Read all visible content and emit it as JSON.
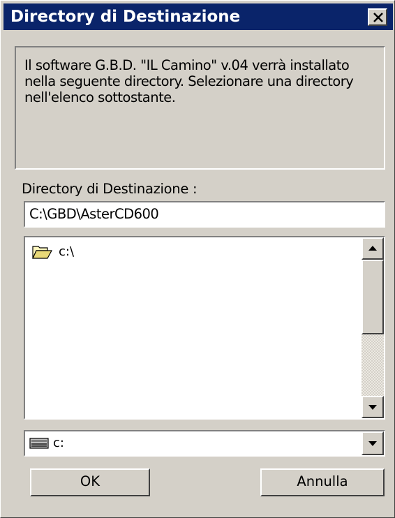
{
  "window": {
    "title": "Directory di Destinazione",
    "close_icon": "close-icon"
  },
  "info": {
    "text": "Il software G.B.D. \"IL Camino\" v.04 verrà installato\nnella seguente directory. Selezionare una directory\nnell'elenco sottostante."
  },
  "destination": {
    "label": "Directory di Destinazione :",
    "path_value": "C:\\GBD\\AsterCD600"
  },
  "directory_list": {
    "items": [
      {
        "label": "c:\\",
        "icon": "open-folder-icon"
      }
    ]
  },
  "drive": {
    "selected": "c:",
    "icon": "drive-icon"
  },
  "buttons": {
    "ok_label": "OK",
    "cancel_label": "Annulla"
  },
  "colors": {
    "titlebar": "#0a246a",
    "face": "#d4d0c8"
  }
}
